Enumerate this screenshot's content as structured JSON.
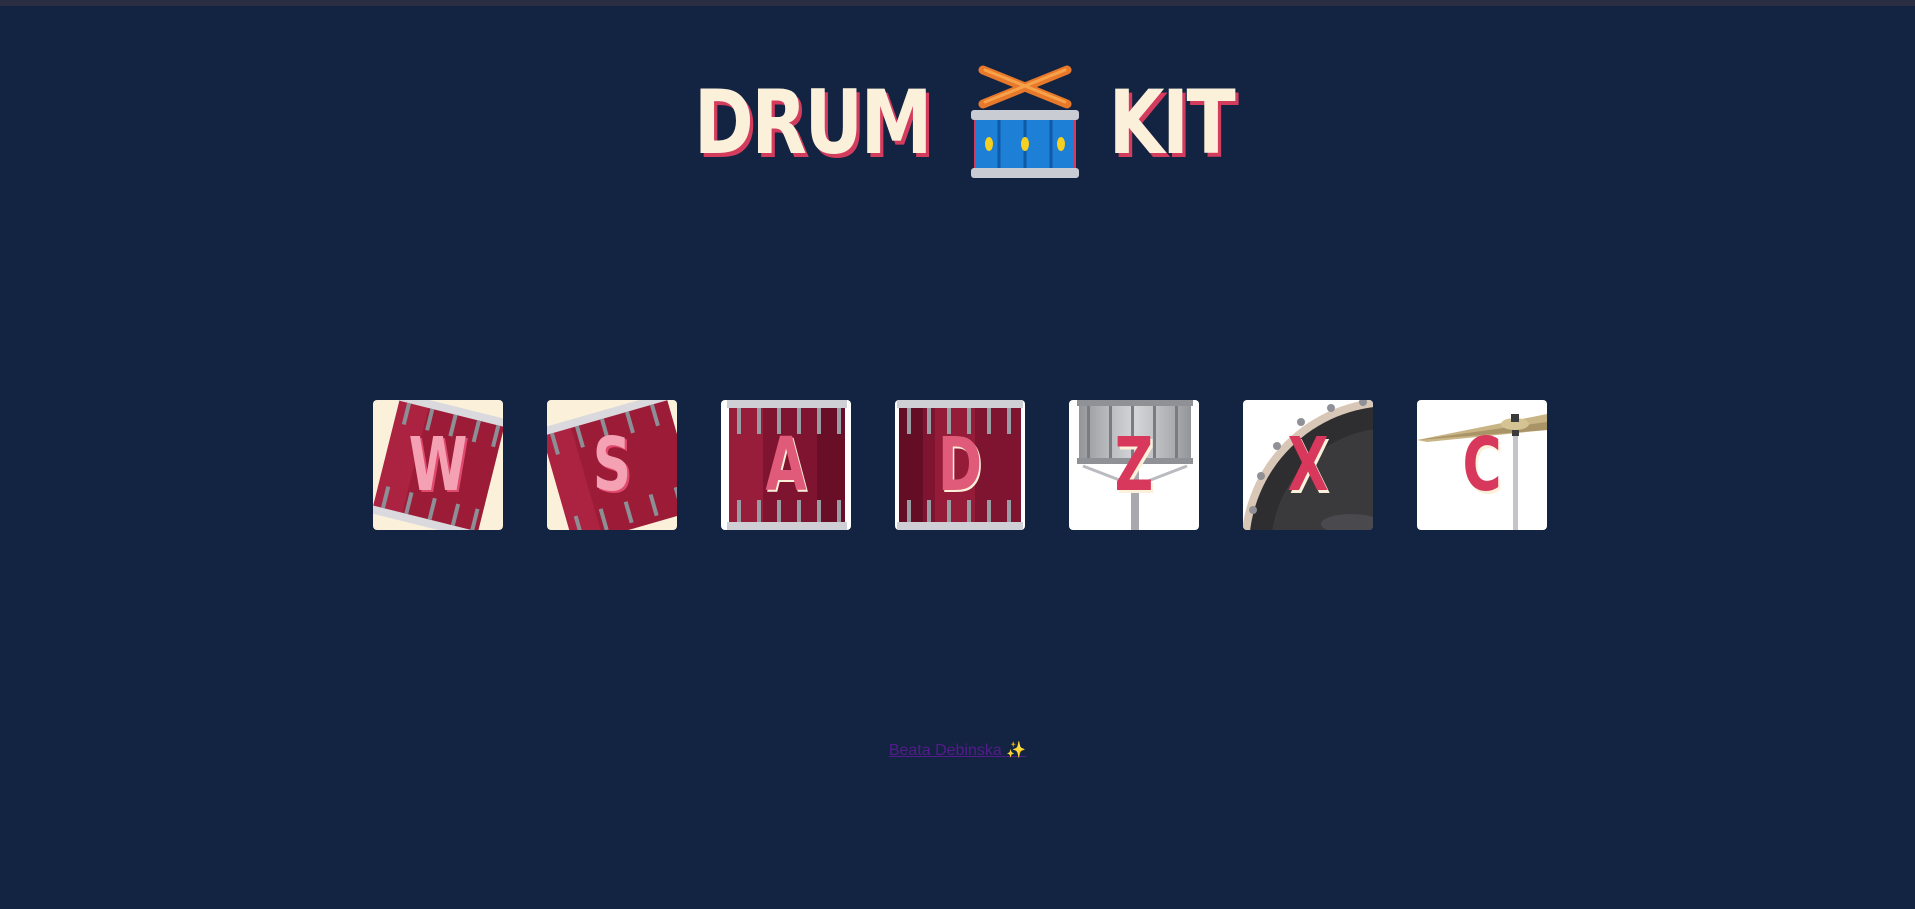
{
  "title": {
    "left_word": "DRUM",
    "right_word": "KIT",
    "emoji_icon": "drum-icon"
  },
  "keys": [
    {
      "letter": "W",
      "instrument_icon": "tom-drum-icon"
    },
    {
      "letter": "S",
      "instrument_icon": "tom-drum-icon"
    },
    {
      "letter": "A",
      "instrument_icon": "floor-tom-icon"
    },
    {
      "letter": "D",
      "instrument_icon": "floor-tom-icon"
    },
    {
      "letter": "Z",
      "instrument_icon": "snare-drum-icon"
    },
    {
      "letter": "X",
      "instrument_icon": "kick-drum-icon"
    },
    {
      "letter": "C",
      "instrument_icon": "cymbal-icon"
    }
  ],
  "footer": {
    "author": "Beata Debinska",
    "sparkle": "✨"
  },
  "colors": {
    "background": "#132442",
    "title_text": "#fbf0da",
    "accent": "#d7385c",
    "drum_red": "#9c1c38",
    "tile_cream": "#fbf0da",
    "tile_white": "#ffffff"
  }
}
